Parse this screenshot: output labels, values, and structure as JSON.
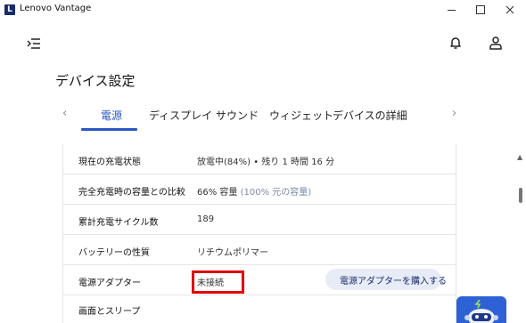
{
  "window": {
    "logo_letter": "L",
    "title": "Lenovo Vantage"
  },
  "header": {
    "page_title": "デバイス設定"
  },
  "tabs": [
    {
      "label": "電源",
      "active": true
    },
    {
      "label": "ディスプレイ",
      "active": false
    },
    {
      "label": "サウンド",
      "active": false
    },
    {
      "label": "ウィジェット",
      "active": false
    },
    {
      "label": "デバイスの詳細",
      "active": false
    }
  ],
  "nav": {
    "prev": "‹",
    "next": "›"
  },
  "battery": {
    "rows": [
      {
        "label": "現在の充電状態",
        "value": "放電中(84%) • 残り 1 時間 16 分"
      },
      {
        "label": "完全充電時の容量との比較",
        "value": "66% 容量",
        "value_muted": "(100% 元の容量)"
      },
      {
        "label": "累計充電サイクル数",
        "value": "189"
      },
      {
        "label": "バッテリーの性質",
        "value": "リチウムポリマー"
      },
      {
        "label": "電源アダプター",
        "value": "未接続"
      },
      {
        "label": "画面とスリープ",
        "value": ""
      }
    ],
    "buy_adapter_label": "電源アダプターを購入する"
  },
  "colors": {
    "accent": "#2a56c6",
    "highlight": "#e00000",
    "button_bg": "#e7ecf7"
  },
  "icons": {
    "menu": "menu-collapse-icon",
    "bell": "bell-icon",
    "user": "user-icon",
    "plug": "plug-icon"
  }
}
